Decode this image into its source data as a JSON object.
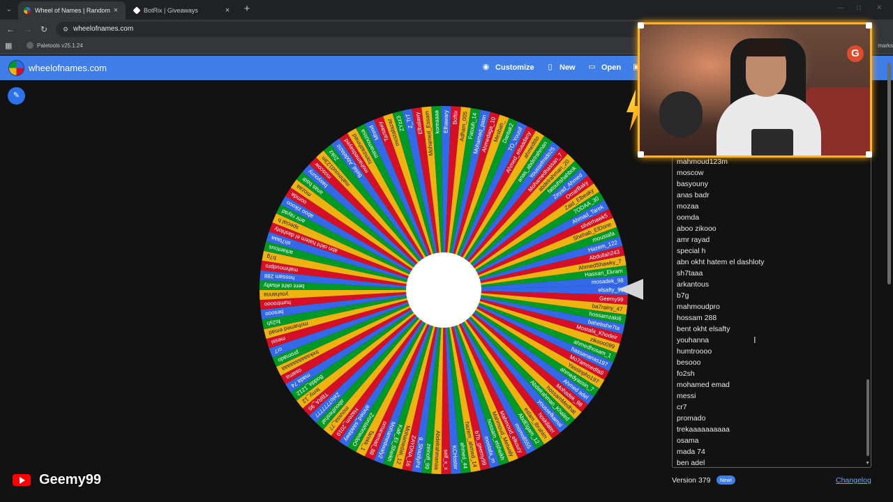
{
  "browser": {
    "tabs": [
      {
        "title": "Wheel of Names | Random nam",
        "favicon_color": "#3f7ee8",
        "active": true
      },
      {
        "title": "BotRix | Giveaways",
        "favicon_color": "#ffffff",
        "active": false
      }
    ],
    "url": "wheelofnames.com",
    "bookmark": "Paletools v25.1.24",
    "bookmarks_right": "marks"
  },
  "site": {
    "title": "wheelofnames.com",
    "header_buttons": [
      {
        "label": "Customize",
        "icon": "palette-icon"
      },
      {
        "label": "New",
        "icon": "new-file-icon"
      },
      {
        "label": "Open",
        "icon": "folder-open-icon"
      }
    ],
    "colors": {
      "header": "#3f7ee8",
      "wheel": [
        "#3369e8",
        "#d50f25",
        "#eeb211",
        "#009925"
      ]
    }
  },
  "wheel": {
    "labels": [
      "elsafty_99",
      "Geemy99",
      "ba7rainy_47",
      "hossamzaki6",
      "bahebshe7ta",
      "Mostafa_Khodeir",
      "zikooo099",
      "ahmedhosam_1",
      "hassananas197",
      "Mo7ammedfa9",
      "Yassinpho197",
      "ahmedyassin_7",
      "Ahmed adel",
      "Mohadek_98",
      "hossamMedhat",
      "Abdelrahman_Khaled",
      "youssefkamal",
      "hoskilater",
      "eslam_ibrahim",
      "AbdElgam_12",
      "momo8555",
      "Mahmoud_elkoury",
      "Mahmoud_Metwaly",
      "hossam_elsheikh",
      "mostafa_m",
      "b7b_geemy99",
      "hazem_ahmed_14",
      "ahmed_44",
      "KCHoster",
      "self_x_x",
      "Abdelrahmanaa",
      "zeinoff_99",
      "g_ShazilyP4",
      "ZAYDNA_16",
      "Mohamedali_12",
      "Kafr_El_Sheikh",
      "Mohamedwaly2",
      "omaremad_88",
      "Tarekk_1",
      "ZrontahmedoO",
      "ahmed_saadawy",
      "Hazem_2019",
      "moussa_77",
      "aboutheshaf",
      "Zelo7777777",
      "TBRA_99",
      "lemy_12",
      "Bodda_1212",
      "mada 74",
      "osama",
      "trekaaaaaaaaaa",
      "promado",
      "cr7",
      "messi",
      "mohamed emad",
      "fo2sh",
      "besooo",
      "humtroooo",
      "youhanna",
      "bent okht elsafty",
      "hossam 288",
      "mahmoudpro",
      "b7g",
      "arkantous",
      "sh7taaa",
      "abn okht hatem el dashloty",
      "special h",
      "amr rayad",
      "aboo zikooo",
      "oomda",
      "mozaa",
      "anas badr",
      "basyouny",
      "moscow",
      "mahmoud123m",
      "Zokz",
      "Belal_Abdelaziz",
      "mohamedsayed",
      "hamzaahmed",
      "minamoussa",
      "Mhmd",
      "Tantawy",
      "mostafazaz",
      "ZYzz3",
      "Z_TrT",
      "Elbalawy",
      "Mohamed_Essam",
      "koreaaaa",
      "Elhawary",
      "Boftix",
      "Adham_005",
      "Fatouh_14",
      "Mohamed_pasn",
      "Ahmedaga_10",
      "Mesbah_",
      "Dantak2",
      "TO_Yousif",
      "Ahmed_elsaadany",
      "ahmedtito",
      "anas_abdelrahman",
      "Youssefmido25",
      "Mohamedhassan_7",
      "abdelrahman_20",
      "fatouhshahbok",
      "Zeyad_Ahmed",
      "OmarBaky",
      "Zaid_Elbeaky",
      "7ODAA_30",
      "Ahmad_Tarek",
      "silverhawk5",
      "Shehab_ElDone",
      "moustafa",
      "Hazem_122",
      "Abdullah243",
      "AhmedShawky_7",
      "Hassan_Ekram",
      "mosadek_98"
    ]
  },
  "entries": [
    "mahmoud123m",
    "moscow",
    "basyouny",
    "anas badr",
    "mozaa",
    "oomda",
    "aboo zikooo",
    "amr rayad",
    "special h",
    "abn okht hatem el dashloty",
    "sh7taaa",
    "arkantous",
    "b7g",
    "mahmoudpro",
    "hossam 288",
    "bent okht elsafty",
    "youhanna",
    "humtroooo",
    "besooo",
    "fo2sh",
    "mohamed emad",
    "messi",
    "cr7",
    "promado",
    "trekaaaaaaaaaa",
    "osama",
    "mada 74",
    "ben adel"
  ],
  "footer": {
    "version": "Version 379",
    "new_badge": "New!",
    "changelog": "Changelog"
  },
  "stream": {
    "channel": "Geemy99",
    "platform_icon": "youtube-icon",
    "cam_logo_letter": "G"
  }
}
